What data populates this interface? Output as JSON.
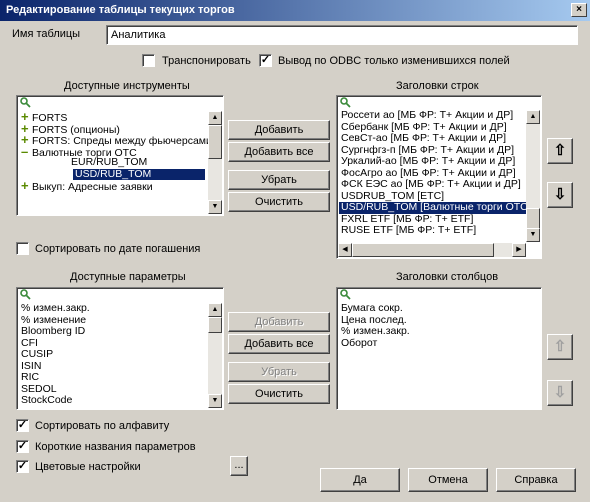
{
  "window": {
    "title": "Редактирование таблицы текущих торгов",
    "close_glyph": "×"
  },
  "table_name": {
    "label": "Имя таблицы",
    "value": "Аналитика"
  },
  "options": {
    "transpose": {
      "label": "Транспонировать",
      "checked": false
    },
    "odbc_changed_only": {
      "label": "Вывод по ODBC только изменившихся  полей",
      "checked": true
    },
    "sort_by_maturity": {
      "label": "Сортировать по дате погашения",
      "checked": false
    },
    "sort_alphabetically": {
      "label": "Сортировать по алфавиту",
      "checked": true
    },
    "short_param_names": {
      "label": "Короткие названия параметров",
      "checked": true
    },
    "color_settings": {
      "label": "Цветовые настройки",
      "checked": true
    }
  },
  "available_instruments": {
    "header": "Доступные инструменты",
    "items": [
      {
        "text": "FORTS",
        "kind": "plus"
      },
      {
        "text": "FORTS (опционы)",
        "kind": "plus"
      },
      {
        "text": "FORTS: Спреды между фьючерсами",
        "kind": "plus"
      },
      {
        "text": "Валютные торги ОТС",
        "kind": "minus"
      },
      {
        "text": "EUR/RUB_TOM",
        "kind": "child"
      },
      {
        "text": "USD/RUB_TOM",
        "kind": "child-selected"
      },
      {
        "text": "Выкуп: Адресные заявки",
        "kind": "plus"
      }
    ]
  },
  "row_headers": {
    "header": "Заголовки строк",
    "items": [
      "Россети ао [МБ ФР: Т+ Акции и ДР]",
      "Сбербанк [МБ ФР: Т+ Акции и ДР]",
      "СевСт-ао [МБ ФР: Т+ Акции и ДР]",
      "Сургнфгз-п [МБ ФР: Т+ Акции и ДР]",
      "Уркалий-ао [МБ ФР: Т+ Акции и ДР]",
      "ФосАгро ао [МБ ФР: Т+ Акции и ДР]",
      "ФСК ЕЭС ао [МБ ФР: Т+ Акции и ДР]",
      "USDRUB_TOM [ETC]",
      "USD/RUB_TOM [Валютные торги ОТС]",
      "FXRL ETF [МБ ФР: Т+ ETF]",
      "RUSE ETF [МБ ФР: Т+ ETF]"
    ],
    "selected_index": 8
  },
  "available_params": {
    "header": "Доступные параметры",
    "items": [
      "% измен.закр.",
      "% изменение",
      "Bloomberg ID",
      "CFI",
      "CUSIP",
      "ISIN",
      "RIC",
      "SEDOL",
      "StockCode"
    ]
  },
  "column_headers": {
    "header": "Заголовки столбцов",
    "items": [
      "Бумага сокр.",
      "Цена послед.",
      "% измен.закр.",
      "Оборот"
    ]
  },
  "buttons": {
    "add": "Добавить",
    "add_all": "Добавить все",
    "remove": "Убрать",
    "clear": "Очистить",
    "ok": "Да",
    "cancel": "Отмена",
    "help": "Справка",
    "ellipsis": "...",
    "move_up": "⇧",
    "move_down": "⇩"
  },
  "colors": {
    "selection": "#0a246a",
    "dialog_bg": "#d4d0c8",
    "expand_plus": "#5a8a00"
  }
}
